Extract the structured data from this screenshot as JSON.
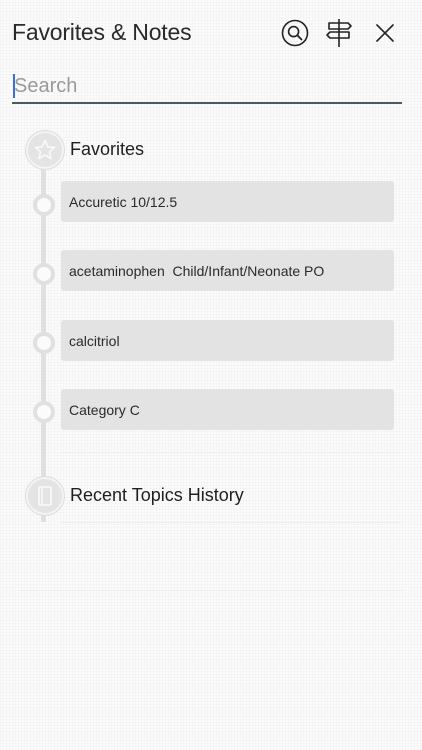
{
  "header": {
    "title": "Favorites & Notes",
    "buttons": [
      {
        "name": "search-button",
        "icon": "magnifier-circle-icon"
      },
      {
        "name": "signpost-button",
        "icon": "signpost-icon"
      },
      {
        "name": "close-button",
        "icon": "close-icon"
      }
    ]
  },
  "search": {
    "placeholder": "Search",
    "value": ""
  },
  "sections": {
    "favorites": {
      "title": "Favorites",
      "icon": "star-icon",
      "items": [
        {
          "label": "Accuretic 10/12.5"
        },
        {
          "label": "acetaminophen  Child/Infant/Neonate PO"
        },
        {
          "label": "calcitriol"
        },
        {
          "label": "Category C"
        }
      ]
    },
    "recent": {
      "title": "Recent Topics History",
      "icon": "book-icon"
    }
  },
  "colors": {
    "background": "#fbfbfb",
    "timeline": "#e0e0e0",
    "item_background": "#e3e3e3",
    "search_underline": "#4a5a66",
    "caret": "#3a6fd8"
  }
}
